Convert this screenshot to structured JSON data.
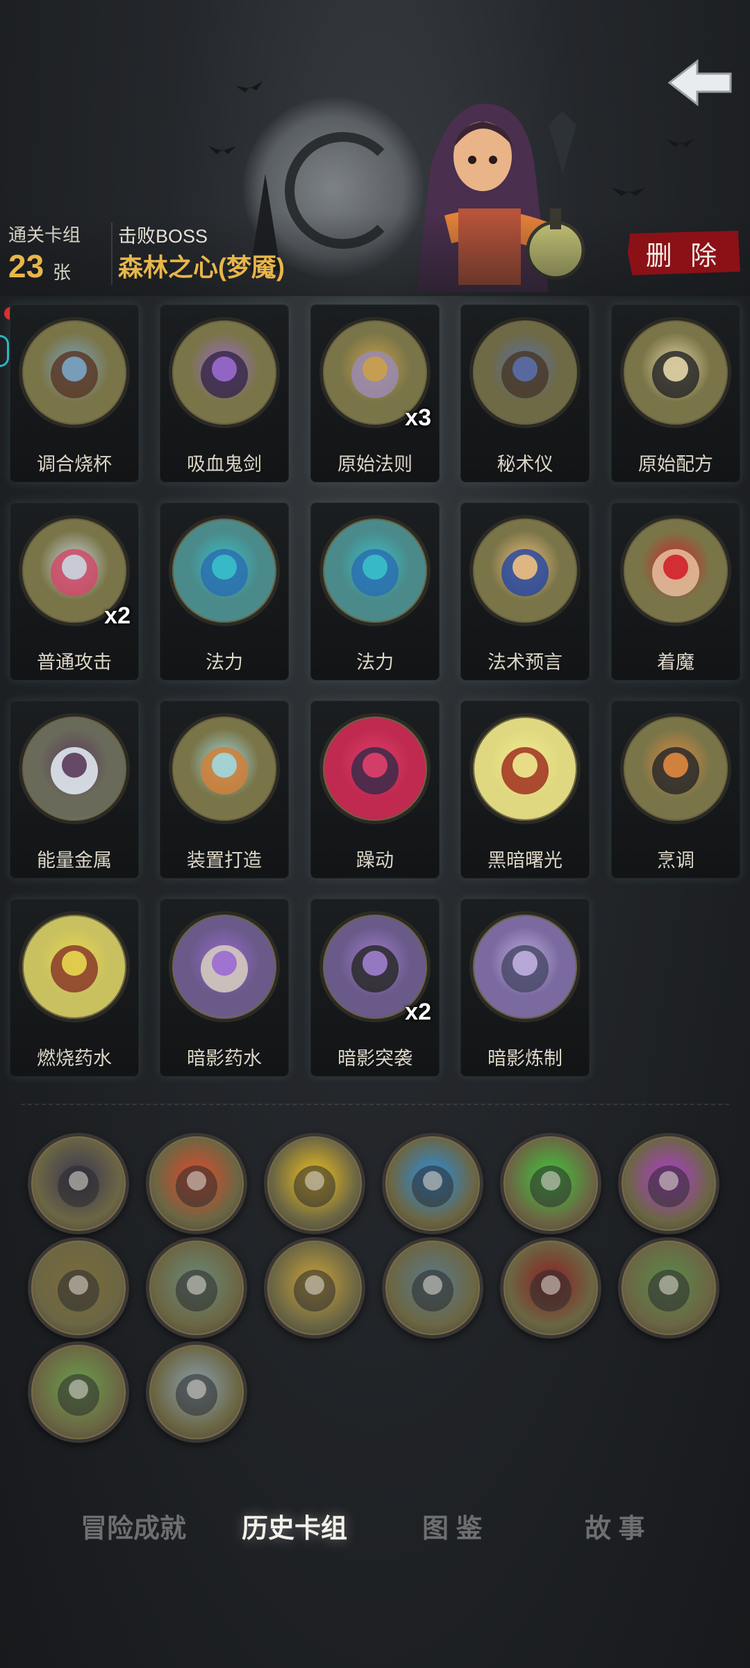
{
  "header": {
    "clear_deck_label": "通关卡组",
    "clear_deck_count": "23",
    "count_unit": "张",
    "boss_label": "击败BOSS",
    "boss_name": "森林之心(梦魇)",
    "delete_label": "删 除"
  },
  "cards": [
    {
      "name": "调合烧杯",
      "count": "",
      "icon": "flask-belt-icon"
    },
    {
      "name": "吸血鬼剑",
      "count": "",
      "icon": "vampire-sword-icon"
    },
    {
      "name": "原始法则",
      "count": "x3",
      "icon": "balance-scale-icon"
    },
    {
      "name": "秘术仪",
      "count": "",
      "icon": "arcane-device-icon"
    },
    {
      "name": "原始配方",
      "count": "",
      "icon": "scroll-icon"
    },
    {
      "name": "普通攻击",
      "count": "x2",
      "icon": "potion-vial-icon"
    },
    {
      "name": "法力",
      "count": "",
      "icon": "mana-orb-icon"
    },
    {
      "name": "法力",
      "count": "",
      "icon": "mana-orb-icon"
    },
    {
      "name": "法术预言",
      "count": "",
      "icon": "crystal-ball-icon"
    },
    {
      "name": "着魔",
      "count": "",
      "icon": "possessed-man-icon"
    },
    {
      "name": "能量金属",
      "count": "",
      "icon": "metal-bar-icon"
    },
    {
      "name": "装置打造",
      "count": "",
      "icon": "glass-dome-icon"
    },
    {
      "name": "躁动",
      "count": "",
      "icon": "frenzy-figure-icon"
    },
    {
      "name": "黑暗曙光",
      "count": "",
      "icon": "dark-creature-icon"
    },
    {
      "name": "烹调",
      "count": "",
      "icon": "fox-chef-icon"
    },
    {
      "name": "燃烧药水",
      "count": "",
      "icon": "fire-potion-icon"
    },
    {
      "name": "暗影药水",
      "count": "",
      "icon": "skeleton-icon"
    },
    {
      "name": "暗影突袭",
      "count": "x2",
      "icon": "reaper-icon"
    },
    {
      "name": "暗影炼制",
      "count": "",
      "icon": "shadow-serpent-icon"
    }
  ],
  "relics": [
    {
      "icon": "dark-nest-icon",
      "color": "#3a3550"
    },
    {
      "icon": "singing-skull-red-icon",
      "color": "#e04a2a"
    },
    {
      "icon": "singing-skull-yellow-icon",
      "color": "#f0c020"
    },
    {
      "icon": "singing-skull-blue-icon",
      "color": "#2a8de0"
    },
    {
      "icon": "singing-skull-green-icon",
      "color": "#3fc83a"
    },
    {
      "icon": "singing-skull-purple-icon",
      "color": "#b03ad0"
    },
    {
      "icon": "dagger-coins-icon",
      "color": "#7a6a3a"
    },
    {
      "icon": "card-hand-icon",
      "color": "#6a8a78"
    },
    {
      "icon": "gold-coins-hand-icon",
      "color": "#c9a23a"
    },
    {
      "icon": "bottled-spirit-icon",
      "color": "#5a7a8a"
    },
    {
      "icon": "vampire-icon",
      "color": "#8a2020"
    },
    {
      "icon": "zombie-duo-icon",
      "color": "#5a8a4a"
    },
    {
      "icon": "ogre-ghost-icon",
      "color": "#6aa04a"
    },
    {
      "icon": "knife-icon",
      "color": "#8aa0b0"
    }
  ],
  "tabs": [
    {
      "label": "冒险成就",
      "active": false
    },
    {
      "label": "历史卡组",
      "active": true
    },
    {
      "label": "图 鉴",
      "active": false
    },
    {
      "label": "故 事",
      "active": false
    }
  ]
}
